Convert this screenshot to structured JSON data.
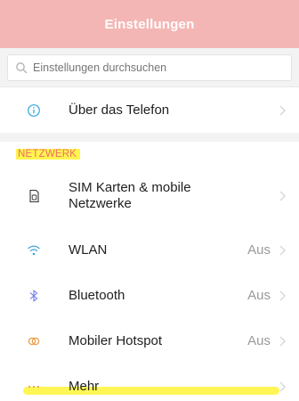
{
  "header": {
    "title": "Einstellungen"
  },
  "search": {
    "placeholder": "Einstellungen durchsuchen",
    "icon": "search-icon"
  },
  "top_items": [
    {
      "label": "Über das Telefon",
      "icon": "info-icon",
      "icon_color": "#2ea6e0"
    }
  ],
  "network_section": {
    "title": "NETZWERK",
    "items": [
      {
        "label_line1": "SIM Karten & mobile",
        "label_line2": "Netzwerke",
        "icon": "sim-card-icon",
        "icon_color": "#333333"
      },
      {
        "label": "WLAN",
        "value": "Aus",
        "icon": "wifi-icon",
        "icon_color": "#3fa5d8"
      },
      {
        "label": "Bluetooth",
        "value": "Aus",
        "icon": "bluetooth-icon",
        "icon_color": "#6f7ee8"
      },
      {
        "label": "Mobiler Hotspot",
        "value": "Aus",
        "icon": "hotspot-icon",
        "icon_color": "#e8a04a"
      },
      {
        "label": "Mehr",
        "icon": "more-icon",
        "icon_color": "#e8a04a"
      }
    ]
  },
  "colors": {
    "titlebar": "#f4b6b4",
    "section_title": "#f06a6a",
    "highlighter": "#fff54d"
  }
}
